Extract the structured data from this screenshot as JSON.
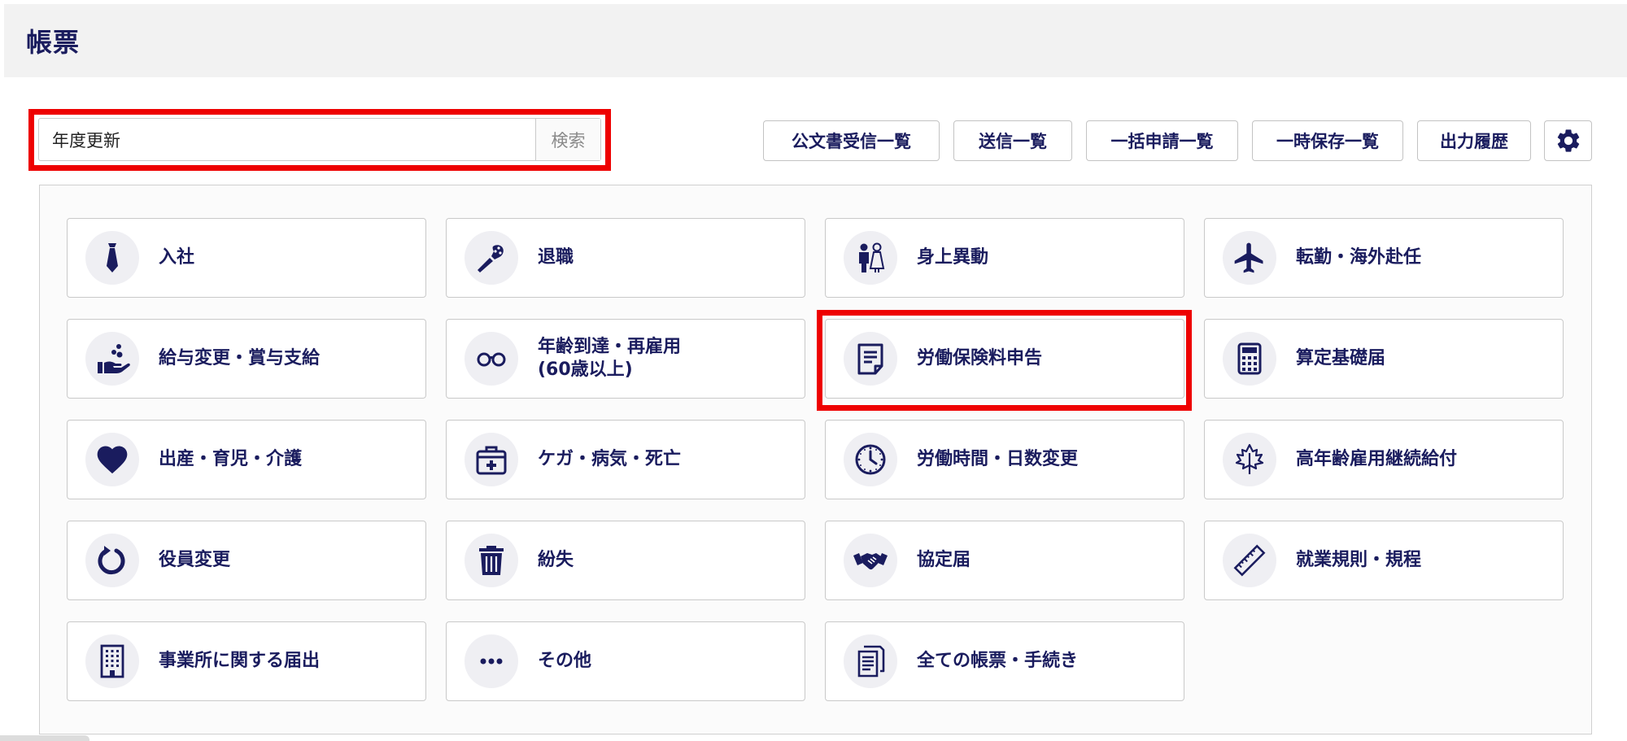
{
  "header": {
    "title": "帳票"
  },
  "search": {
    "value": "年度更新",
    "button_label": "検索"
  },
  "toolbar": {
    "received_docs_label": "公文書受信一覧",
    "sent_label": "送信一覧",
    "bulk_label": "一括申請一覧",
    "temp_saved_label": "一時保存一覧",
    "output_history_label": "出力履歴",
    "settings_icon": "gear-icon"
  },
  "colors": {
    "accent": "#1a1c5e",
    "highlight": "#ee0000"
  },
  "categories": [
    {
      "label": "入社",
      "icon": "necktie-icon"
    },
    {
      "label": "退職",
      "icon": "bouquet-icon"
    },
    {
      "label": "身上異動",
      "icon": "wedding-couple-icon"
    },
    {
      "label": "転勤・海外赴任",
      "icon": "airplane-icon"
    },
    {
      "label": "給与変更・賞与支給",
      "icon": "coins-hand-icon"
    },
    {
      "label": "年齢到達・再雇用\n(60歳以上)",
      "icon": "glasses-icon"
    },
    {
      "label": "労働保険料申告",
      "icon": "document-icon"
    },
    {
      "label": "算定基礎届",
      "icon": "calculator-icon"
    },
    {
      "label": "出産・育児・介護",
      "icon": "heart-icon"
    },
    {
      "label": "ケガ・病気・死亡",
      "icon": "first-aid-icon"
    },
    {
      "label": "労働時間・日数変更",
      "icon": "clock-icon"
    },
    {
      "label": "高年齢雇用継続給付",
      "icon": "maple-leaf-icon"
    },
    {
      "label": "役員変更",
      "icon": "refresh-icon"
    },
    {
      "label": "紛失",
      "icon": "trash-icon"
    },
    {
      "label": "協定届",
      "icon": "handshake-icon"
    },
    {
      "label": "就業規則・規程",
      "icon": "ruler-icon"
    },
    {
      "label": "事業所に関する届出",
      "icon": "building-icon"
    },
    {
      "label": "その他",
      "icon": "ellipsis-icon"
    },
    {
      "label": "全ての帳票・手続き",
      "icon": "documents-icon"
    }
  ]
}
